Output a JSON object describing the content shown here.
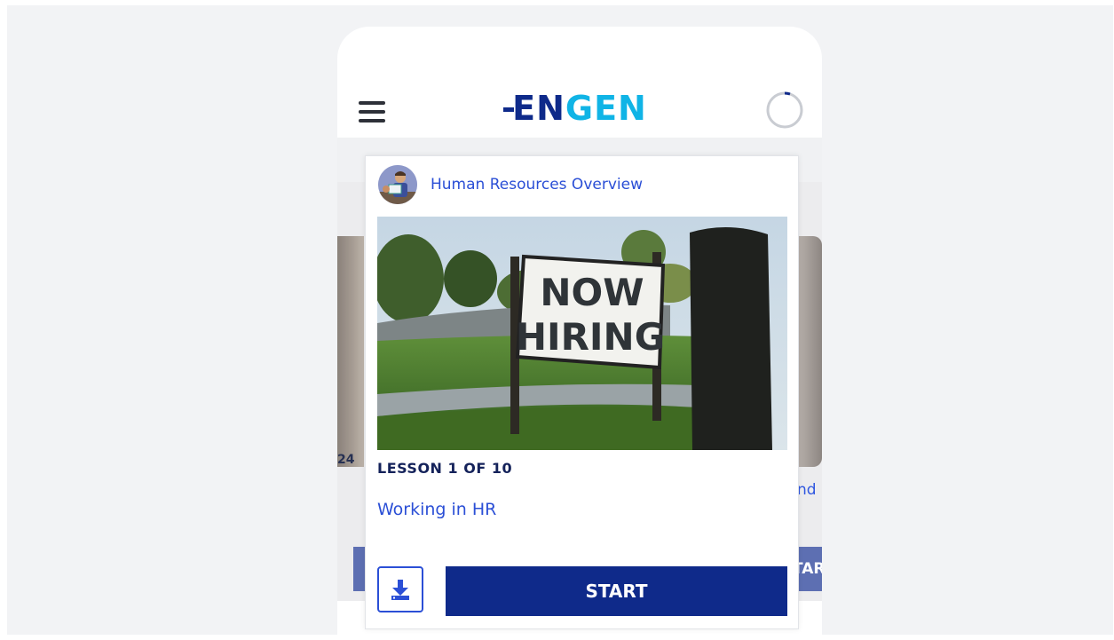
{
  "header": {
    "logo_part1": "EN",
    "logo_part2": "GEN",
    "menu_icon": "hamburger-menu-icon",
    "progress_icon": "progress-ring-icon"
  },
  "carousel": {
    "left_card_number": "24",
    "right_card_text": "nd",
    "right_card_button": "TAR"
  },
  "card": {
    "course_title": "Human Resources Overview",
    "image_sign_line1": "NOW",
    "image_sign_line2": "HIRING",
    "lesson_count": "LESSON 1 OF 10",
    "lesson_title": "Working in HR",
    "download_icon": "download-icon",
    "start_label": "START"
  },
  "colors": {
    "brand_dark": "#0f2a8a",
    "brand_light": "#10b4e6",
    "link_blue": "#2b4fd6"
  }
}
